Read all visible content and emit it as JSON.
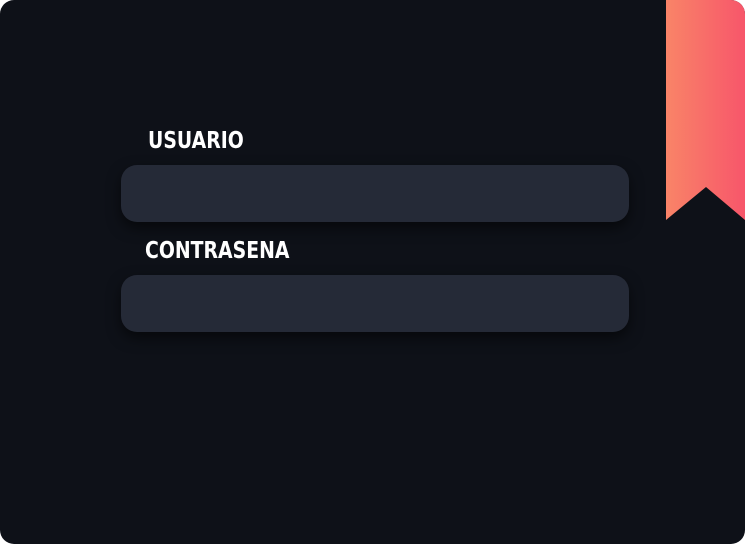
{
  "form": {
    "username": {
      "label": "USUARIO",
      "value": "",
      "placeholder": ""
    },
    "password": {
      "label": "CONTRASENA",
      "value": "",
      "placeholder": ""
    }
  },
  "colors": {
    "card_background": "#0e1118",
    "input_background": "#252a37",
    "label_text": "#ffffff",
    "bookmark_gradient_start": "#f98468",
    "bookmark_gradient_end": "#f7566a"
  }
}
